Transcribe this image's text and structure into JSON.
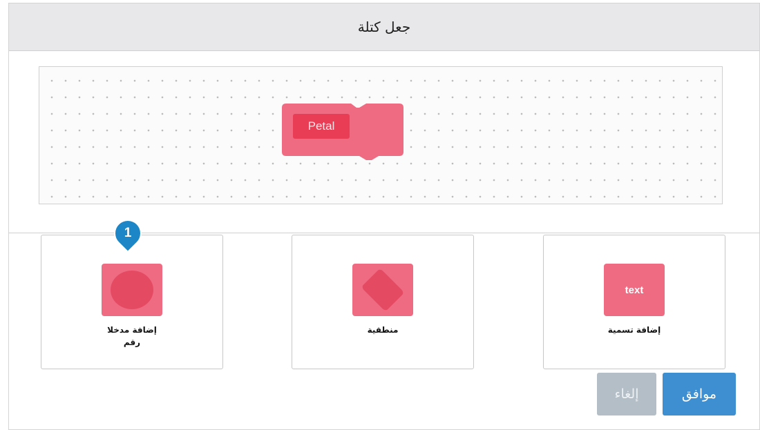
{
  "dialog": {
    "title": "جعل كتلة",
    "ok_label": "موافق",
    "cancel_label": "إلغاء"
  },
  "workspace": {
    "block_label": "Petal",
    "block_color": "#ef6b82"
  },
  "options": [
    {
      "label_line1": "إضافة مدخلا",
      "label_line2": "رقم",
      "icon": "round-input-icon"
    },
    {
      "label": "منطقية",
      "icon": "boolean-input-icon"
    },
    {
      "label": "إضافة تسمية",
      "icon_text": "text",
      "icon": "text-label-icon"
    }
  ],
  "callout": {
    "number": "1",
    "color": "#1d86c7"
  },
  "colors": {
    "accent": "#3d8fd1",
    "block": "#ef6b82",
    "block_dark": "#e54a63"
  }
}
